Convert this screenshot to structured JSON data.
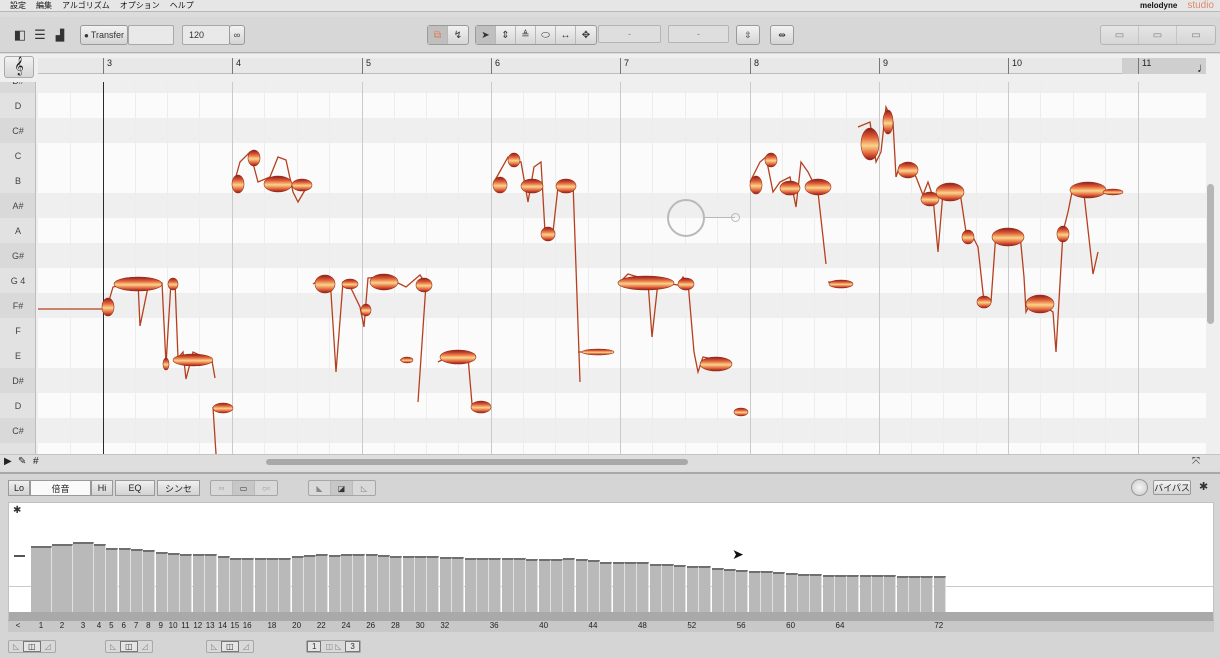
{
  "menu": [
    "設定",
    "編集",
    "アルゴリズム",
    "オプション",
    "ヘルプ"
  ],
  "brand": {
    "name": "melodyne",
    "edition": "studio"
  },
  "toolbar": {
    "transfer_label": "Transfer",
    "tempo": "120",
    "field_a": "-",
    "field_b": "-"
  },
  "ruler": {
    "bars": [
      "3",
      "4",
      "5",
      "6",
      "7",
      "8",
      "9",
      "10",
      "11"
    ]
  },
  "piano_keys": [
    "D#",
    "D",
    "C#",
    "C",
    "B",
    "A#",
    "A",
    "G#",
    "G 4",
    "F#",
    "F",
    "E",
    "D#",
    "D",
    "C#"
  ],
  "sound_editor": {
    "tabs": [
      "Lo",
      "倍音",
      "Hi",
      "EQ",
      "シンセ"
    ],
    "bypass_label": "バイパス",
    "harmonic_numbers": [
      "<",
      "1",
      "2",
      "3",
      "4",
      "5",
      "6",
      "7",
      "8",
      "9",
      "10",
      "11",
      "12",
      "13",
      "14",
      "15",
      "16",
      "18",
      "20",
      "22",
      "24",
      "26",
      "28",
      "30",
      "32",
      "36",
      "40",
      "44",
      "48",
      "52",
      "56",
      "60",
      "64",
      "72"
    ],
    "bottom_value_a": "1",
    "bottom_value_b": "3"
  },
  "harmonic_levels": [
    0.82,
    0.85,
    0.88,
    0.85,
    0.8,
    0.8,
    0.79,
    0.77,
    0.75,
    0.74,
    0.73,
    0.73,
    0.72,
    0.7,
    0.67,
    0.67,
    0.68,
    0.68,
    0.68,
    0.7,
    0.71,
    0.72,
    0.71,
    0.72,
    0.72,
    0.72,
    0.71,
    0.7,
    0.7,
    0.7,
    0.7,
    0.69,
    0.69,
    0.68,
    0.68,
    0.68,
    0.67,
    0.67,
    0.66,
    0.66,
    0.66,
    0.67,
    0.66,
    0.65,
    0.63,
    0.63,
    0.63,
    0.62,
    0.6,
    0.6,
    0.59,
    0.58,
    0.57,
    0.55,
    0.54,
    0.52,
    0.51,
    0.51,
    0.5,
    0.49,
    0.48,
    0.47,
    0.46,
    0.46,
    0.46,
    0.46,
    0.46,
    0.46,
    0.45,
    0.45,
    0.45,
    0.45
  ]
}
